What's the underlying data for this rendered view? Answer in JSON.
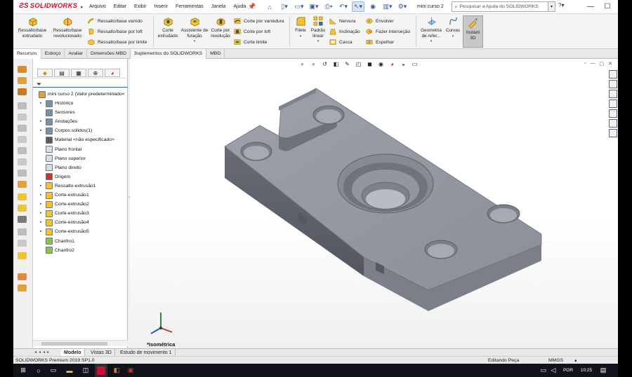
{
  "app": {
    "brand": "SOLIDWORKS",
    "document_title": "mini curso 2"
  },
  "menu": [
    "Arquivo",
    "Editar",
    "Exibir",
    "Inserir",
    "Ferramentas",
    "Janela",
    "Ajuda"
  ],
  "search": {
    "placeholder": "Pesquisar a Ajuda do SOLIDWORKS"
  },
  "ribbon": {
    "extruded_boss": "Ressalto/base extrudado",
    "revolved_boss": "Ressalto/base revolucionado",
    "swept_boss": "Ressalto/base varrido",
    "lofted_boss": "Ressalto/base por loft",
    "boundary_boss": "Ressalto/base por limite",
    "extruded_cut": "Corte extrudado",
    "hole_wizard": "Assistente de furação",
    "revolved_cut": "Corte por revolução",
    "swept_cut": "Corte por varredura",
    "lofted_cut": "Corte por loft",
    "boundary_cut": "Corte limite",
    "fillet": "Filete",
    "linear_pattern": "Padrão linear",
    "rib": "Nervura",
    "draft": "Inclinação",
    "shell": "Casca",
    "wrap": "Envolver",
    "intersect": "Fazer interseção",
    "mirror": "Espelhar",
    "reference_geometry": "Geometria de refer...",
    "curves": "Curvas",
    "instant3d": "Instant 3D"
  },
  "tabs": [
    "Recursos",
    "Esboço",
    "Avaliar",
    "Dimensões MBD",
    "Suplementos do SOLIDWORKS",
    "MBD"
  ],
  "tree": [
    {
      "label": "mini curso 2  (Valor predeterminado<",
      "icon": "part-icon",
      "exp": false,
      "indent": 0
    },
    {
      "label": "Histórico",
      "icon": "history-icon",
      "exp": true,
      "indent": 1
    },
    {
      "label": "Sensores",
      "icon": "sensor-icon",
      "exp": false,
      "indent": 1
    },
    {
      "label": "Anotações",
      "icon": "annotation-icon",
      "exp": true,
      "indent": 1
    },
    {
      "label": "Corpos sólidos(1)",
      "icon": "solid-bodies-icon",
      "exp": true,
      "indent": 1
    },
    {
      "label": "Material <não especificado>",
      "icon": "material-icon",
      "exp": false,
      "indent": 1
    },
    {
      "label": "Plano frontal",
      "icon": "plane-icon",
      "exp": false,
      "indent": 1
    },
    {
      "label": "Plano superior",
      "icon": "plane-icon",
      "exp": false,
      "indent": 1
    },
    {
      "label": "Plano direito",
      "icon": "plane-icon",
      "exp": false,
      "indent": 1
    },
    {
      "label": "Origem",
      "icon": "origin-icon",
      "exp": false,
      "indent": 1
    },
    {
      "label": "Ressalto-extrusão1",
      "icon": "extrude-boss-icon",
      "exp": true,
      "indent": 1
    },
    {
      "label": "Corte-extrusão1",
      "icon": "cut-extrude-icon",
      "exp": true,
      "indent": 1
    },
    {
      "label": "Corte-extrusão2",
      "icon": "cut-extrude-icon",
      "exp": true,
      "indent": 1
    },
    {
      "label": "Corte-extrusão3",
      "icon": "cut-extrude-icon",
      "exp": true,
      "indent": 1
    },
    {
      "label": "Corte-extrusão4",
      "icon": "cut-extrude-icon",
      "exp": true,
      "indent": 1
    },
    {
      "label": "Corte-extrusão5",
      "icon": "cut-extrude-icon",
      "exp": true,
      "indent": 1
    },
    {
      "label": "Chanfro1",
      "icon": "chamfer-icon",
      "exp": false,
      "indent": 1
    },
    {
      "label": "Chanfro2",
      "icon": "chamfer-icon",
      "exp": false,
      "indent": 1
    }
  ],
  "viewport": {
    "view_label": "*Isométrica"
  },
  "bottom_tabs": [
    "Modelo",
    "Vistas 3D",
    "Estudo de movimento 1"
  ],
  "status": {
    "version": "SOLIDWORKS Premium 2019 SP1.0",
    "mode": "Editando Peça",
    "units": "MMGS"
  },
  "taskbar": {
    "language": "POR",
    "time": "10:25"
  },
  "colors": {
    "brand_red": "#c8102e",
    "accent_blue": "#2b6cb0",
    "part_gray": "#8a8d96"
  }
}
